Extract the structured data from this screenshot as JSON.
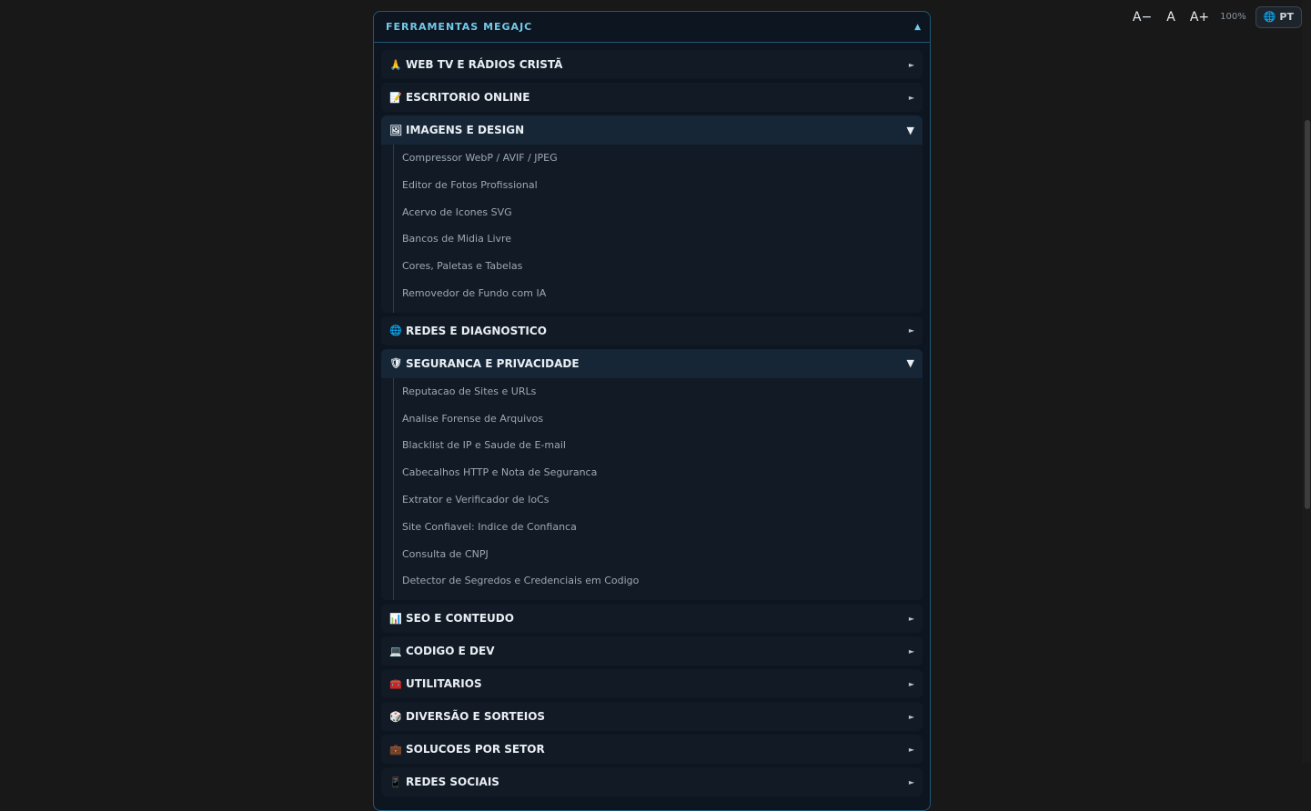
{
  "toolbar": {
    "font_decrease": "A−",
    "font_reset": "A",
    "font_increase": "A+",
    "zoom": "100%",
    "language": "PT"
  },
  "panel": {
    "title": "FERRAMENTAS MEGAJC",
    "collapse_caret": "▲"
  },
  "categories": [
    {
      "emoji": "🙏",
      "label": "WEB TV E RÁDIOS CRISTÃ",
      "arrow": "►"
    },
    {
      "emoji": "📝",
      "label": "ESCRITORIO ONLINE",
      "arrow": "►"
    },
    {
      "emoji": "🖼",
      "label": "IMAGENS E DESIGN",
      "arrow": "▼",
      "items": [
        "Compressor WebP / AVIF / JPEG",
        "Editor de Fotos Profissional",
        "Acervo de Icones SVG",
        "Bancos de Midia Livre",
        "Cores, Paletas e Tabelas",
        "Removedor de Fundo com IA"
      ]
    },
    {
      "emoji": "🌐",
      "label": "REDES E DIAGNOSTICO",
      "arrow": "►"
    },
    {
      "emoji": "🛡",
      "label": "SEGURANCA E PRIVACIDADE",
      "arrow": "▼",
      "items": [
        "Reputacao de Sites e URLs",
        "Analise Forense de Arquivos",
        "Blacklist de IP e Saude de E-mail",
        "Cabecalhos HTTP e Nota de Seguranca",
        "Extrator e Verificador de IoCs",
        "Site Confiavel: Indice de Confianca",
        "Consulta de CNPJ",
        "Detector de Segredos e Credenciais em Codigo"
      ]
    },
    {
      "emoji": "📊",
      "label": "SEO E CONTEUDO",
      "arrow": "►"
    },
    {
      "emoji": "💻",
      "label": "CODIGO E DEV",
      "arrow": "►"
    },
    {
      "emoji": "🧰",
      "label": "UTILITARIOS",
      "arrow": "►"
    },
    {
      "emoji": "🎲",
      "label": "DIVERSÃO E SORTEIOS",
      "arrow": "►"
    },
    {
      "emoji": "💼",
      "label": "SOLUCOES POR SETOR",
      "arrow": "►"
    },
    {
      "emoji": "📱",
      "label": "REDES SOCIAIS",
      "arrow": "►"
    }
  ]
}
